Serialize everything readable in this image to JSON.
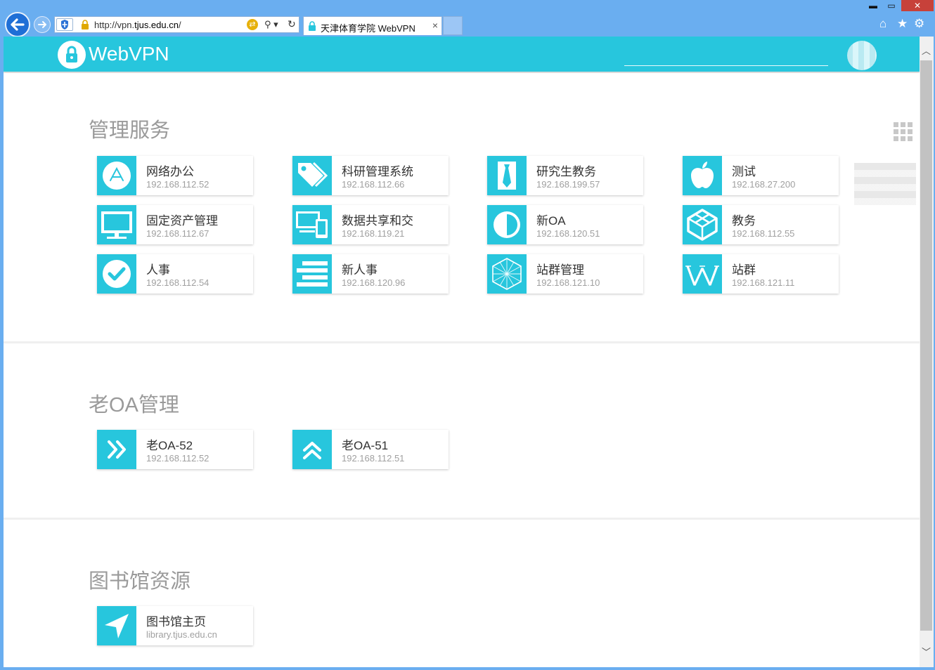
{
  "browser": {
    "url_prefix": "http://vpn.",
    "url_domain": "tjus.edu.cn",
    "url_suffix": "/",
    "tab_title": "天津体育学院 WebVPN",
    "tab_close": "×",
    "window_min": "▬",
    "window_max": "▭",
    "window_close": "✕"
  },
  "header": {
    "logo_text": "WebVPN"
  },
  "sections": [
    {
      "title": "管理服务",
      "apps": [
        {
          "name": "网络办公",
          "ip": "192.168.112.52",
          "icon": "apptype-a-icon"
        },
        {
          "name": "科研管理系统",
          "ip": "192.168.112.66",
          "icon": "tags-icon"
        },
        {
          "name": "研究生教务",
          "ip": "192.168.199.57",
          "icon": "tie-icon"
        },
        {
          "name": "测试",
          "ip": "192.168.27.200",
          "icon": "apple-icon"
        },
        {
          "name": "固定资产管理",
          "ip": "192.168.112.67",
          "icon": "monitor-icon"
        },
        {
          "name": "数据共享和交",
          "ip": "192.168.119.21",
          "icon": "devices-icon"
        },
        {
          "name": "新OA",
          "ip": "192.168.120.51",
          "icon": "half-circle-icon"
        },
        {
          "name": "教务",
          "ip": "192.168.112.55",
          "icon": "cube-icon"
        },
        {
          "name": "人事",
          "ip": "192.168.112.54",
          "icon": "check-circle-icon"
        },
        {
          "name": "新人事",
          "ip": "192.168.120.96",
          "icon": "align-lines-icon"
        },
        {
          "name": "站群管理",
          "ip": "192.168.121.10",
          "icon": "hexagon-mesh-icon"
        },
        {
          "name": "站群",
          "ip": "192.168.121.11",
          "icon": "wikipedia-w-icon"
        }
      ]
    },
    {
      "title": "老OA管理",
      "apps": [
        {
          "name": "老OA-52",
          "ip": "192.168.112.52",
          "icon": "double-chevron-right-icon"
        },
        {
          "name": "老OA-51",
          "ip": "192.168.112.51",
          "icon": "double-chevron-up-icon"
        }
      ]
    },
    {
      "title": "图书馆资源",
      "apps": [
        {
          "name": "图书馆主页",
          "ip": "library.tjus.edu.cn",
          "icon": "location-arrow-icon"
        }
      ]
    }
  ],
  "colors": {
    "accent": "#27c6dd",
    "chrome": "#6aaef0"
  }
}
